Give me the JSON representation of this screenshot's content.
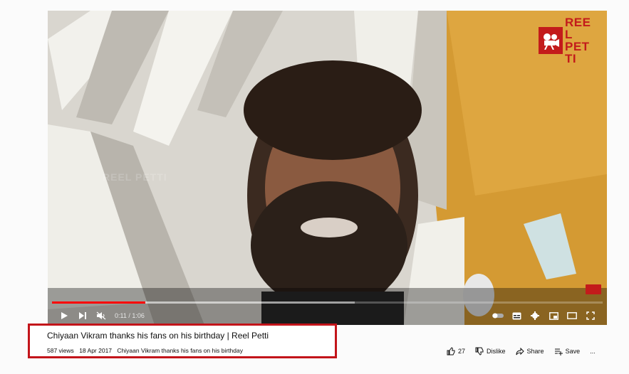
{
  "video": {
    "channel_logo_text": "REEL PETTI",
    "watermark_text": "REEL PETTI",
    "time_display": "0:11 / 1:06",
    "played_fraction": 0.17,
    "loaded_fraction": 0.55
  },
  "info": {
    "title": "Chiyaan Vikram thanks his fans on his birthday | Reel Petti",
    "views": "587 views",
    "date": "18 Apr 2017",
    "description": "Chiyaan Vikram thanks his fans on his birthday"
  },
  "actions": {
    "like_count": "27",
    "dislike_label": "Dislike",
    "share_label": "Share",
    "save_label": "Save",
    "more_label": "..."
  },
  "colors": {
    "accent": "#ff0000",
    "highlight_box": "#c3141a",
    "brand": "#c31b1b"
  }
}
